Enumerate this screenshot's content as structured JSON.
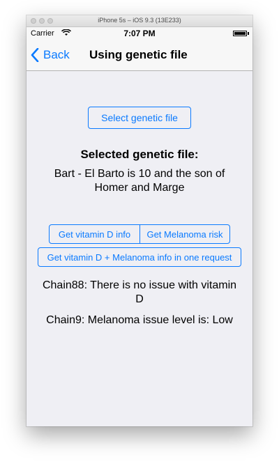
{
  "simulator": {
    "title": "iPhone 5s – iOS 9.3 (13E233)"
  },
  "status_bar": {
    "carrier": "Carrier",
    "time": "7:07 PM"
  },
  "nav": {
    "back_label": "Back",
    "title": "Using genetic file"
  },
  "main": {
    "select_button": "Select genetic file",
    "selected_heading": "Selected genetic file:",
    "selected_file": "Bart - El Barto is 10 and the son of Homer and Marge",
    "vitamin_d_button": "Get vitamin D info",
    "melanoma_button": "Get Melanoma risk",
    "combined_button": "Get vitamin D + Melanoma info in one request",
    "result_vitamin_d": "Chain88: There is no issue with vitamin D",
    "result_melanoma": "Chain9: Melanoma issue level is: Low"
  },
  "colors": {
    "accent": "#0a7aff",
    "background": "#efeff4"
  },
  "icons": {
    "back": "chevron-left-icon",
    "wifi": "wifi-icon",
    "battery": "battery-icon"
  }
}
